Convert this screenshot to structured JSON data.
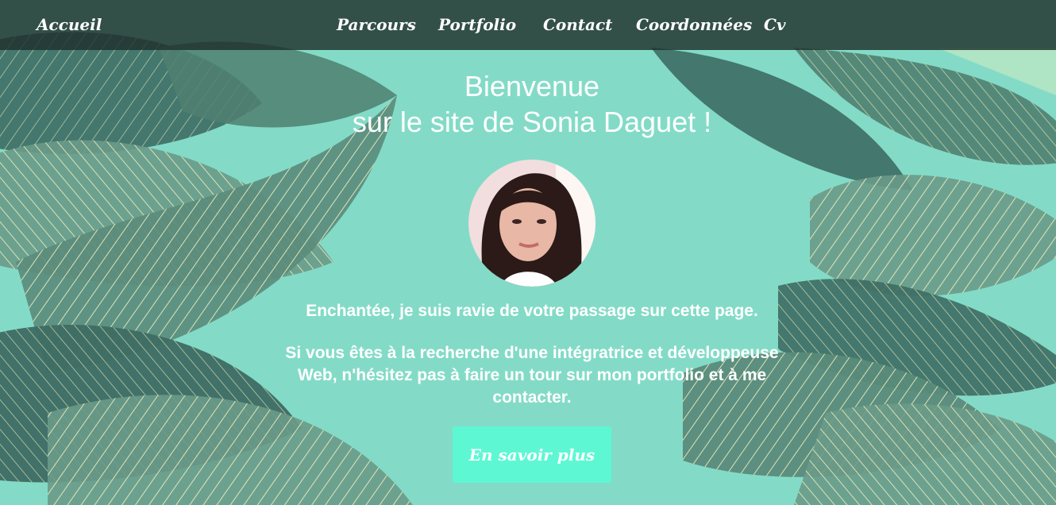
{
  "nav": {
    "home": "Accueil",
    "items": [
      "Parcours",
      "Portfolio",
      "Contact",
      "Coordonnées",
      "Cv"
    ]
  },
  "hero": {
    "title_line1": "Bienvenue",
    "title_line2": "sur le site de Sonia Daguet !",
    "intro": "Enchantée, je suis ravie de votre passage sur cette page.",
    "pitch": "Si vous êtes à la recherche d'une intégratrice et développeuse Web, n'hésitez pas à faire un tour sur mon portfolio et à me contacter.",
    "cta_label": "En savoir plus"
  },
  "colors": {
    "background": "#83dbc7",
    "navbar": "#20302c",
    "leaf_dark": "#3d6b63",
    "leaf_mid": "#6a9a88",
    "leaf_vein": "#f3f3c0",
    "cta": "#5ef7d4"
  }
}
